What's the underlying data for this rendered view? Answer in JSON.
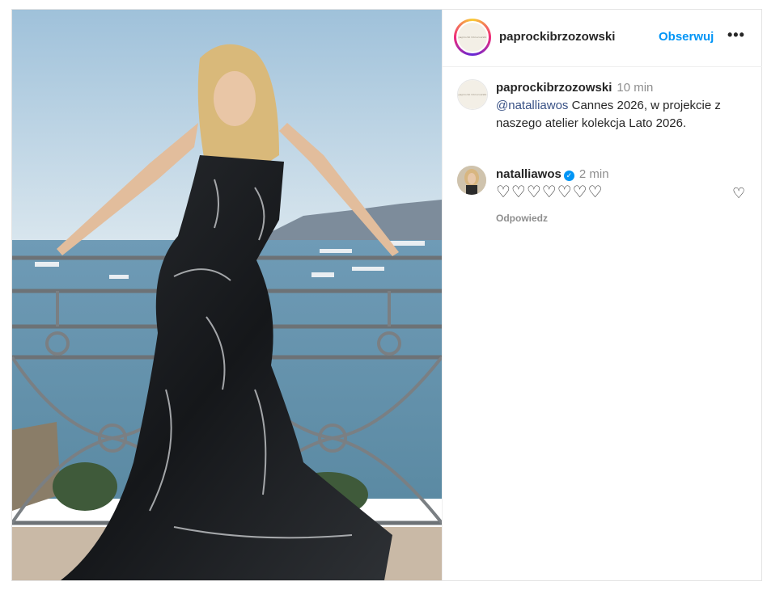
{
  "post": {
    "author": "paprockibrzozowski",
    "follow_label": "Obserwuj",
    "more_label": "•••",
    "avatar_logo_text": "paprocki brzozowski",
    "photo_icon": "photo-woman-black-gown-balcony"
  },
  "caption": {
    "username": "paprockibrzozowski",
    "time": "10 min",
    "mention": "@natalliawos",
    "text": " Cannes 2026, w projekcie z naszego atelier kolekcja Lato 2026."
  },
  "comment": {
    "username": "natalliawos",
    "verified_icon": "verified-badge-icon",
    "time": "2 min",
    "text": "♡♡♡♡♡♡♡",
    "reply_label": "Odpowiedz",
    "like_icon": "♡"
  },
  "colors": {
    "link": "#0095f6",
    "mention": "#385185",
    "muted": "#8e8e8e",
    "text": "#262626"
  }
}
